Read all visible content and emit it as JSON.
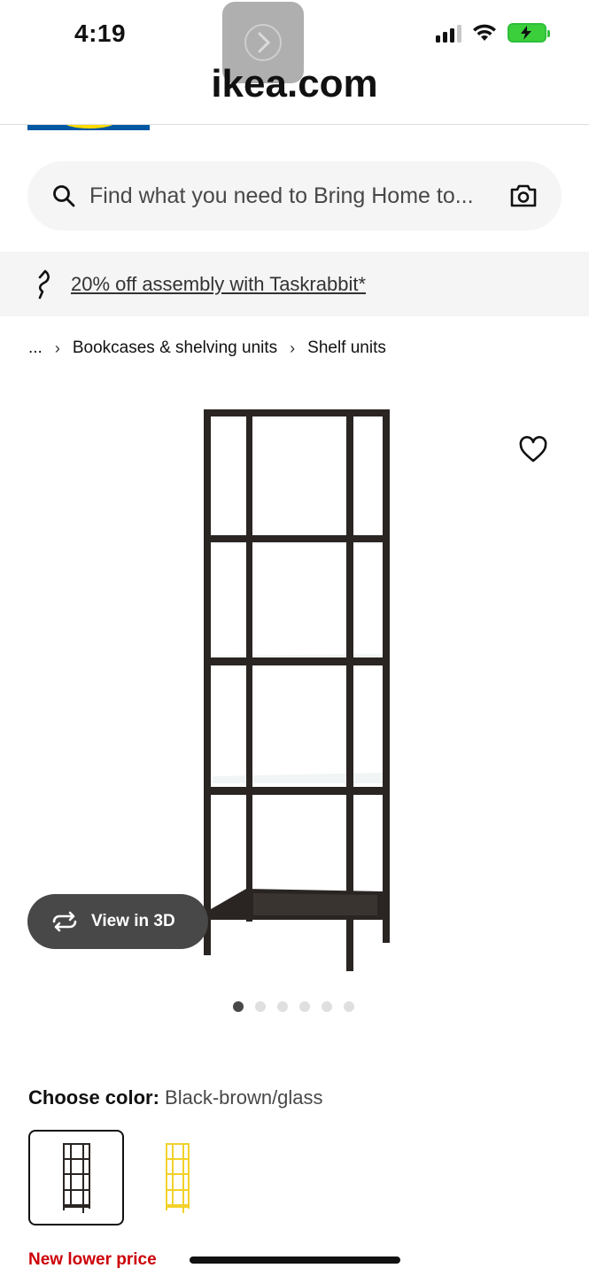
{
  "status_bar": {
    "time": "4:19",
    "signal_icon": "signal-icon",
    "wifi_icon": "wifi-icon",
    "battery_icon": "battery-charging-icon"
  },
  "browser": {
    "url": "ikea.com"
  },
  "search": {
    "placeholder": "Find what you need to Bring Home to..."
  },
  "promo": {
    "text": "20% off assembly with Taskrabbit*"
  },
  "breadcrumb": {
    "ellipsis": "...",
    "items": [
      "Bookcases & shelving units",
      "Shelf units"
    ]
  },
  "product": {
    "view3d_label": "View in 3D",
    "image_count": 6,
    "active_image": 1
  },
  "color": {
    "label": "Choose color:",
    "value": "Black-brown/glass"
  },
  "price_badge": "New lower price",
  "colors": {
    "brand_blue": "#0058a3",
    "brand_yellow": "#ffdb00",
    "price_red": "#cc0008"
  }
}
